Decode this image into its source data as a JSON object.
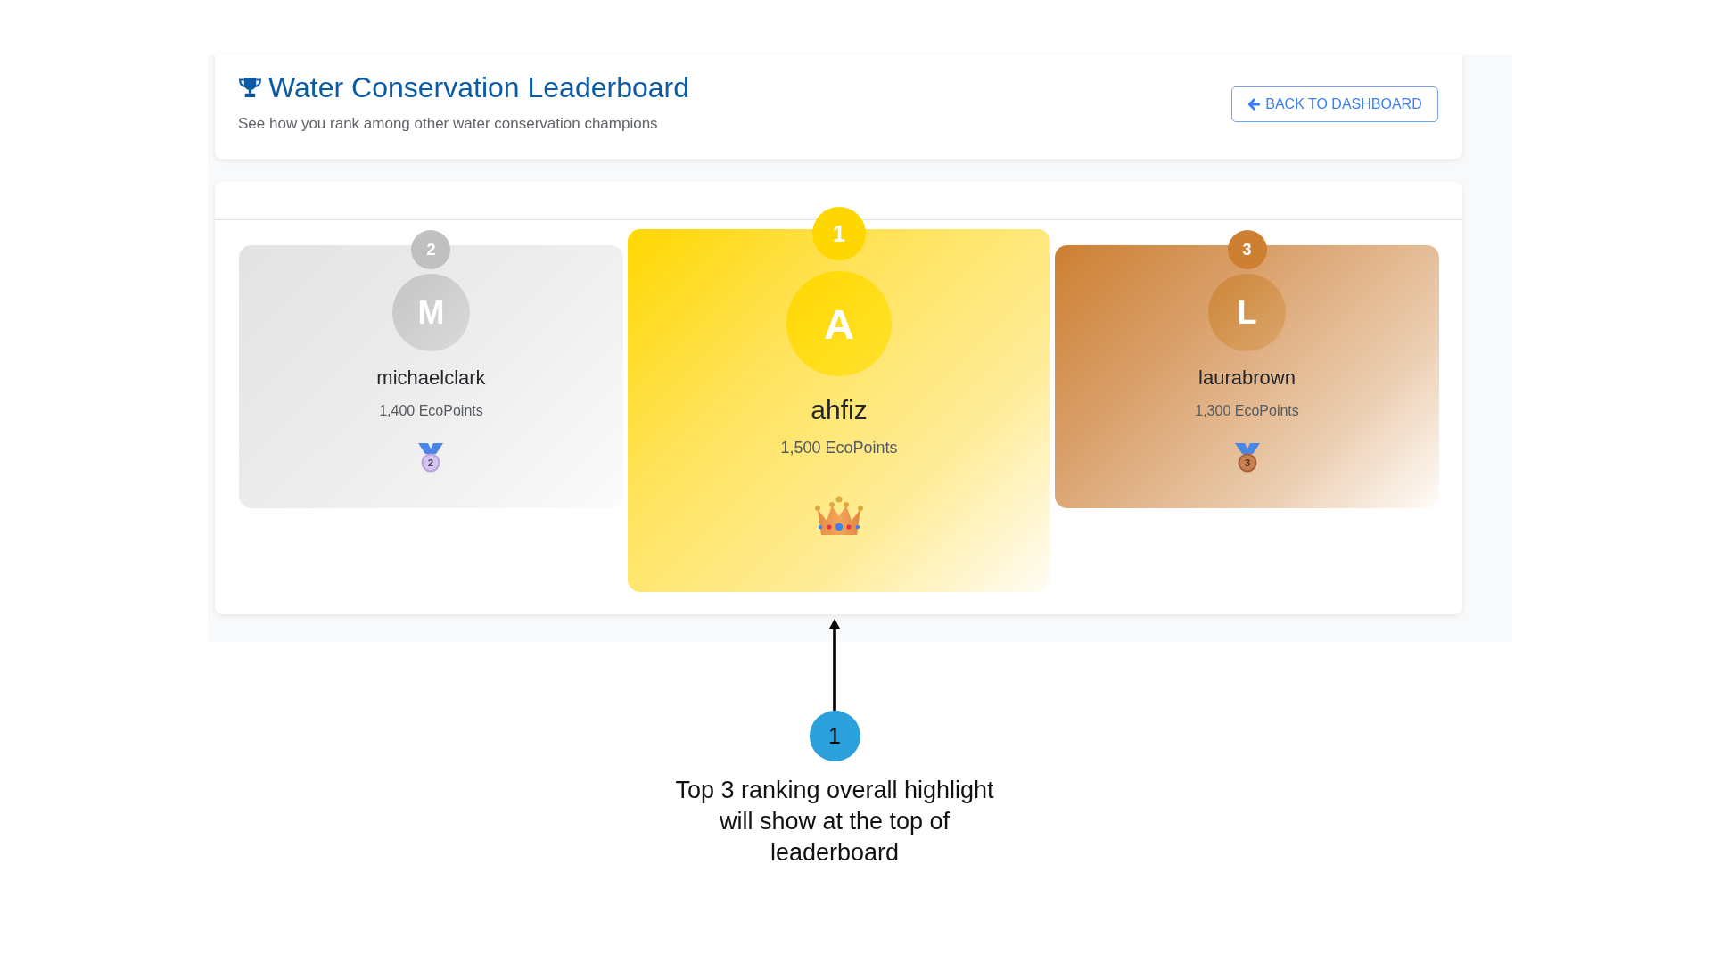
{
  "header": {
    "title": "Water Conservation Leaderboard",
    "subtitle": "See how you rank among other water conservation champions",
    "back_button": "BACK TO DASHBOARD"
  },
  "podium": [
    {
      "kind": "silver",
      "rank": "2",
      "color": "#c0c0c0",
      "initial": "M",
      "name": "michaelclark",
      "points": "1,400 EcoPoints",
      "medal_label": "2"
    },
    {
      "kind": "gold",
      "rank": "1",
      "color": "#ffd700",
      "initial": "A",
      "name": "ahfiz",
      "points": "1,500 EcoPoints"
    },
    {
      "kind": "bronze",
      "rank": "3",
      "color": "#cd7f32",
      "initial": "L",
      "name": "laurabrown",
      "points": "1,300 EcoPoints",
      "medal_label": "3"
    }
  ],
  "annotation": {
    "number": "1",
    "text": "Top 3 ranking overall highlight will show at the top of leaderboard"
  }
}
